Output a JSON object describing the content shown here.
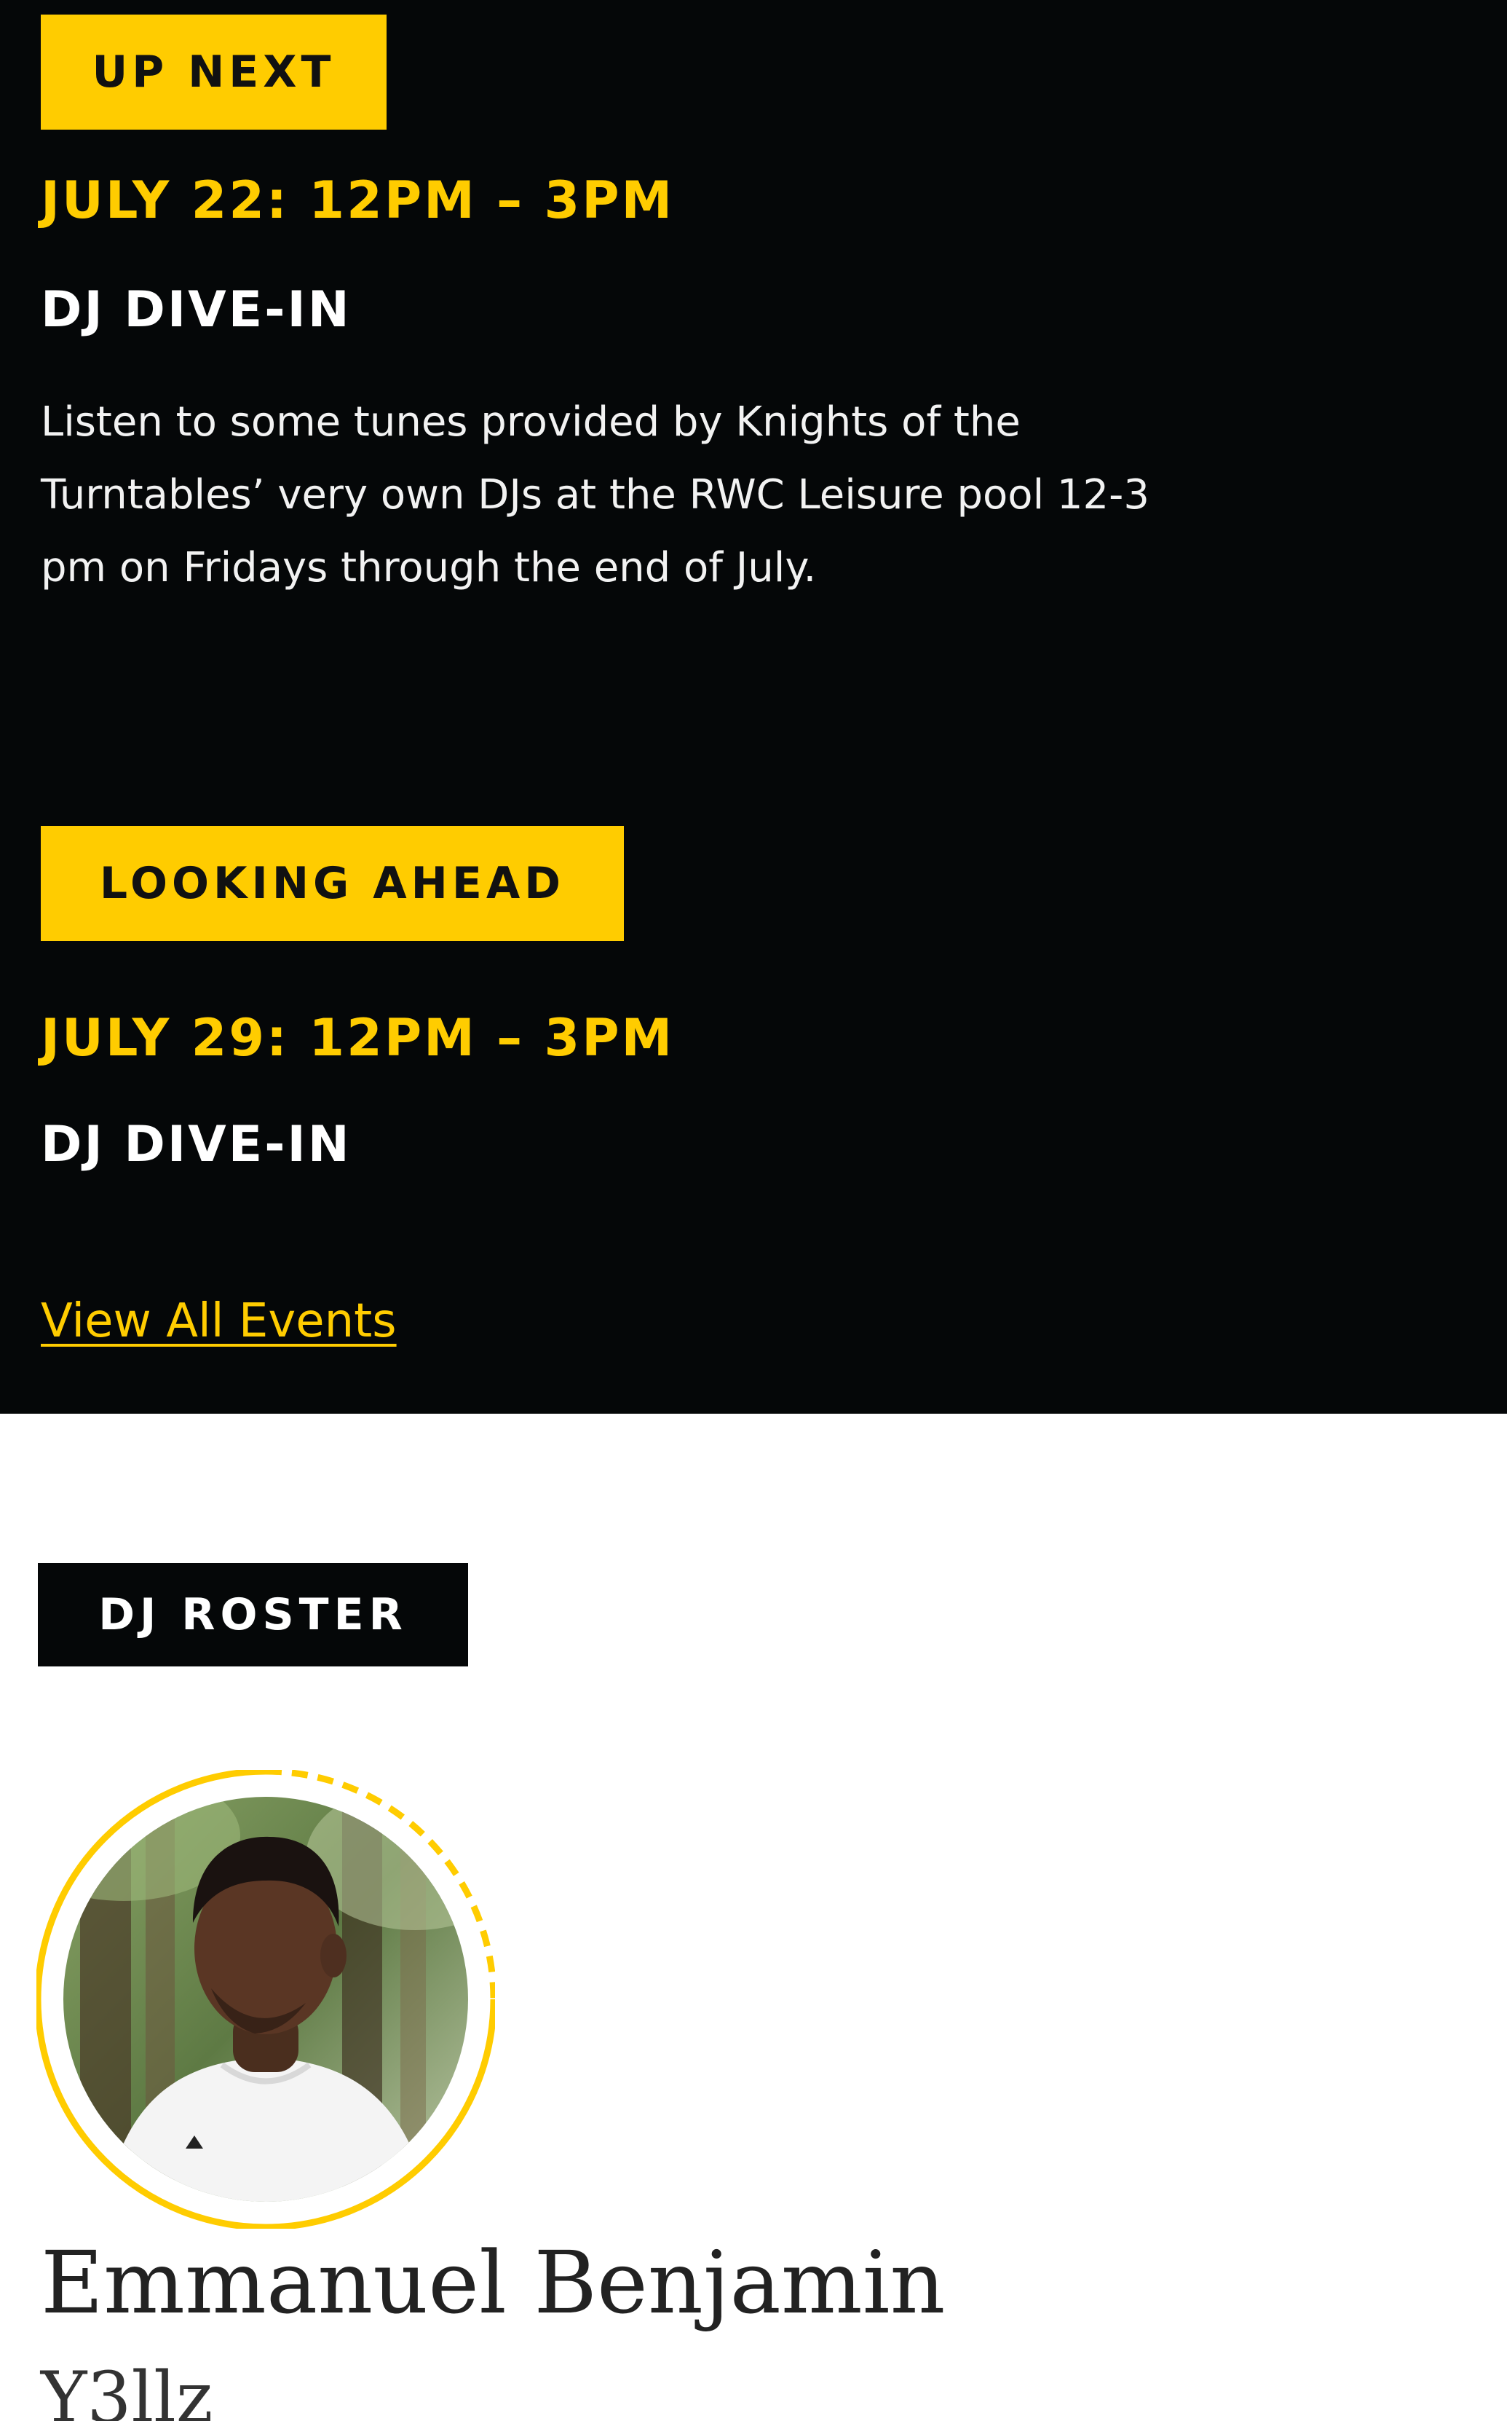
{
  "colors": {
    "accent": "#ffcc00",
    "dark_bg": "#050708",
    "white": "#ffffff"
  },
  "up_next": {
    "tag": "UP NEXT",
    "date": "JULY 22: 12PM – 3PM",
    "title": "DJ DIVE-IN",
    "description": "Listen to some tunes provided by Knights of the Turntables’ very own DJs at the RWC Leisure pool 12-3 pm on Fridays through the end of July."
  },
  "looking_ahead": {
    "tag": "LOOKING AHEAD",
    "date": "JULY 29: 12PM – 3PM",
    "title": "DJ DIVE-IN"
  },
  "view_all_link": "View All Events",
  "roster": {
    "tag": "DJ ROSTER",
    "djs": [
      {
        "name": "Emmanuel Benjamin",
        "alias": "Y3llz",
        "avatar_icon": "dj-photo-avatar"
      }
    ]
  }
}
